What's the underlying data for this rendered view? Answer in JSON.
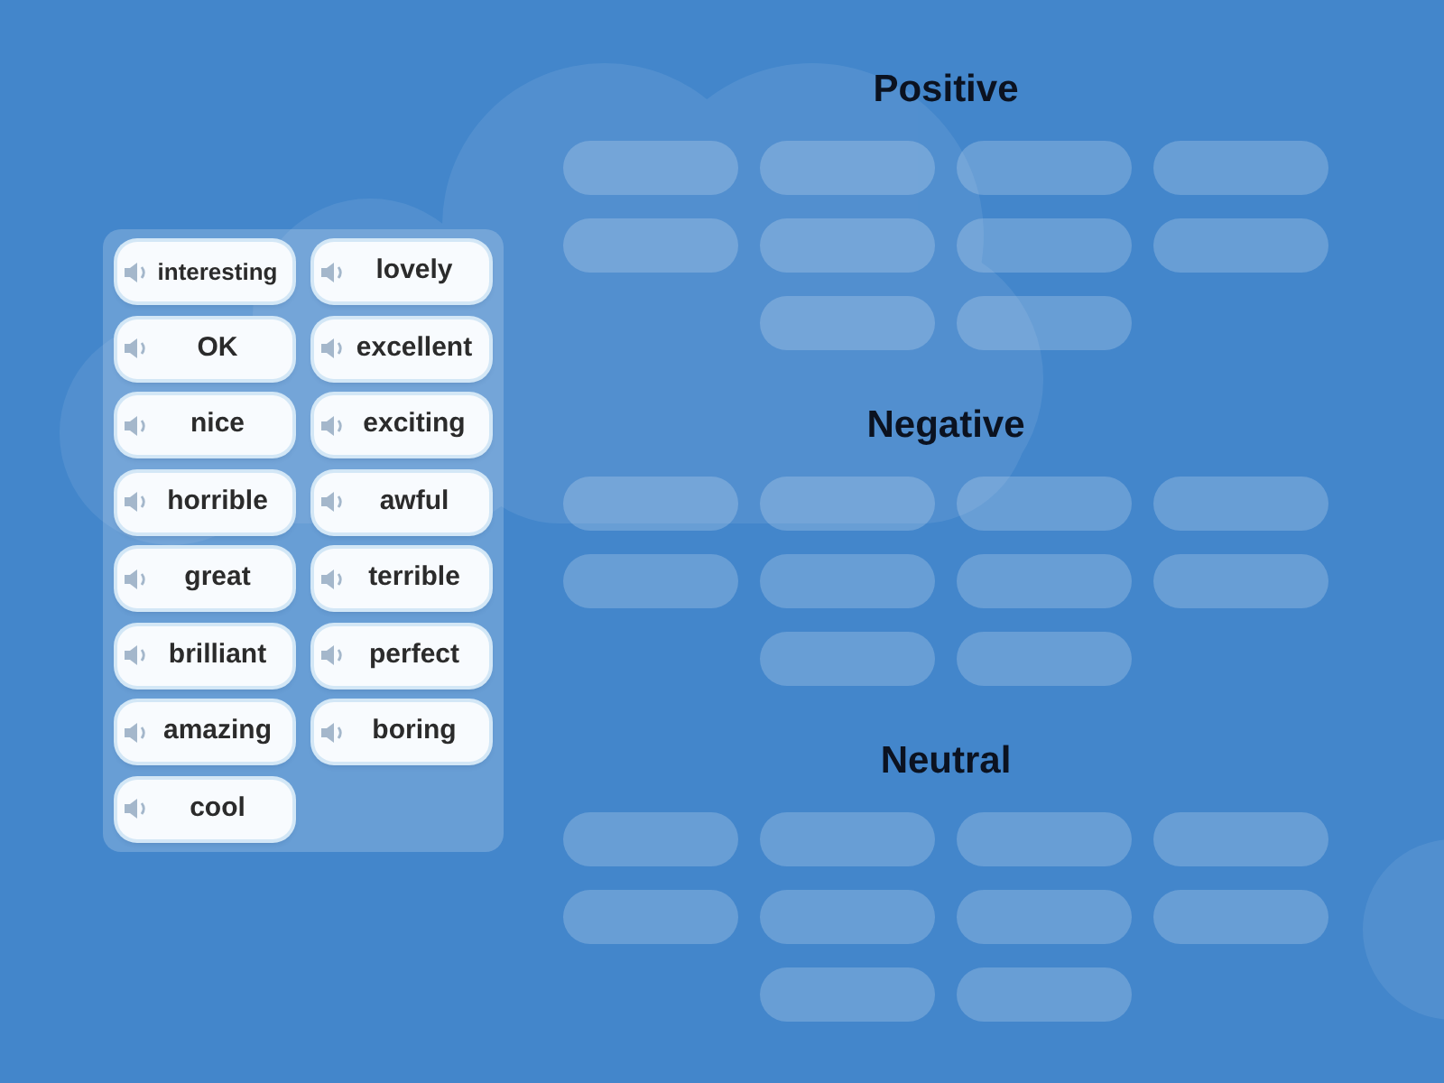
{
  "word_bank": {
    "items": [
      {
        "text": "interesting"
      },
      {
        "text": "lovely"
      },
      {
        "text": "OK"
      },
      {
        "text": "excellent"
      },
      {
        "text": "nice"
      },
      {
        "text": "exciting"
      },
      {
        "text": "horrible"
      },
      {
        "text": "awful"
      },
      {
        "text": "great"
      },
      {
        "text": "terrible"
      },
      {
        "text": "brilliant"
      },
      {
        "text": "perfect"
      },
      {
        "text": "amazing"
      },
      {
        "text": "boring"
      },
      {
        "text": "cool"
      }
    ]
  },
  "groups": [
    {
      "title": "Positive",
      "slots": [
        {
          "empty": true
        },
        {
          "empty": true
        },
        {
          "empty": true
        },
        {
          "empty": true
        },
        {
          "empty": true
        },
        {
          "empty": true
        },
        {
          "empty": true
        },
        {
          "empty": true
        },
        {
          "empty": true
        },
        {
          "empty": true
        }
      ]
    },
    {
      "title": "Negative",
      "slots": [
        {
          "empty": true
        },
        {
          "empty": true
        },
        {
          "empty": true
        },
        {
          "empty": true
        },
        {
          "empty": true
        },
        {
          "empty": true
        },
        {
          "empty": true
        },
        {
          "empty": true
        },
        {
          "empty": true
        },
        {
          "empty": true
        }
      ]
    },
    {
      "title": "Neutral",
      "slots": [
        {
          "empty": true
        },
        {
          "empty": true
        },
        {
          "empty": true
        },
        {
          "empty": true
        },
        {
          "empty": true
        },
        {
          "empty": true
        },
        {
          "empty": true
        },
        {
          "empty": true
        },
        {
          "empty": true
        },
        {
          "empty": true
        }
      ]
    }
  ]
}
